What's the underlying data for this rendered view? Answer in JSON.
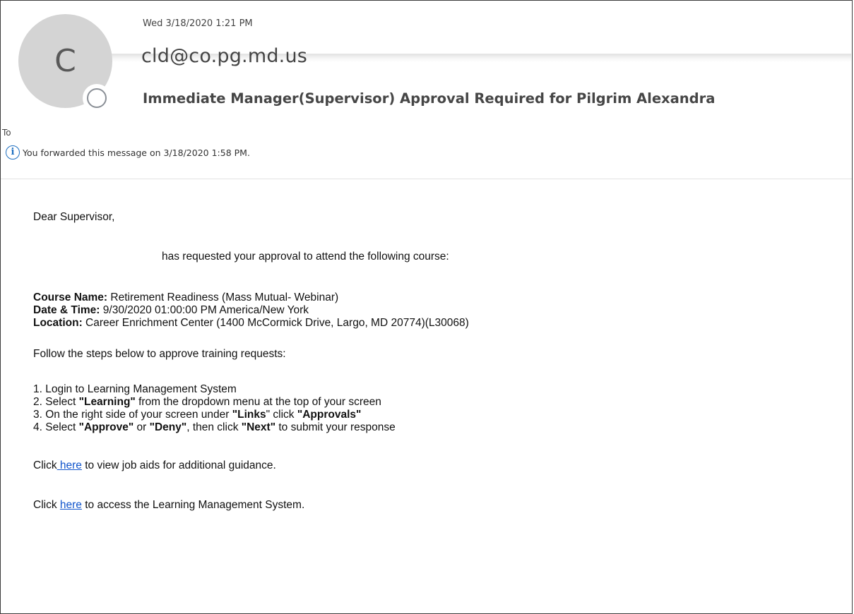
{
  "header": {
    "avatar_initial": "C",
    "sent_date": "Wed 3/18/2020 1:21 PM",
    "sender": "cld@co.pg.md.us",
    "subject": "Immediate Manager(Supervisor) Approval Required for Pilgrim Alexandra",
    "to_label": "To",
    "info_icon": "info-icon",
    "info_text": "You forwarded this message on 3/18/2020 1:58 PM."
  },
  "body": {
    "greeting": "Dear Supervisor,",
    "request_line": "has requested your approval to attend the following course:",
    "course_name_label": "Course Name:",
    "course_name_value": " Retirement Readiness (Mass Mutual- Webinar)",
    "datetime_label": "Date & Time:",
    "datetime_value": " 9/30/2020 01:00:00 PM America/New York",
    "location_label": "Location:",
    "location_value": " Career Enrichment Center (1400 McCormick Drive, Largo, MD 20774)(L30068)",
    "steps_intro": "Follow the steps below to approve training requests:",
    "step1": "1. Login to Learning Management System",
    "step2_a": "2. Select ",
    "step2_b": "\"Learning\"",
    "step2_c": " from the dropdown menu at the top of your screen",
    "step3_a": "3. On the right side of your screen under ",
    "step3_b": "\"Links",
    "step3_c": "\" click ",
    "step3_d": "\"Approvals\"",
    "step4_a": "4. Select ",
    "step4_b": "\"Approve\"",
    "step4_c": " or ",
    "step4_d": "\"Deny\"",
    "step4_e": ", then click ",
    "step4_f": "\"Next\"",
    "step4_g": " to submit your response",
    "job_aids_prefix": "Click",
    "job_aids_link": " here",
    "job_aids_suffix": " to view job aids for additional guidance.",
    "lms_prefix": "Click ",
    "lms_link": "here",
    "lms_suffix": " to access the Learning Management System."
  }
}
